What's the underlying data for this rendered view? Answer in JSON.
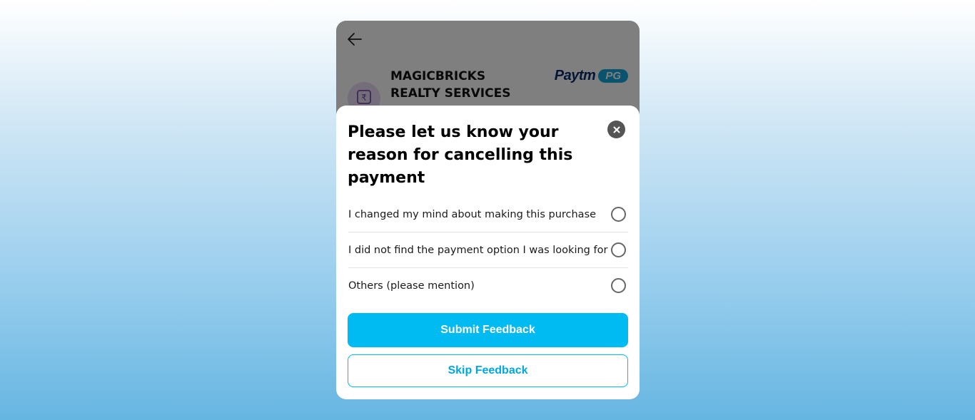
{
  "merchant": {
    "name": "MAGICBRICKS REALTY SERVICES",
    "logo_icon": "rupee-wallet-icon"
  },
  "brand": {
    "paytm_label": "Paytm",
    "pg_label": "PG",
    "paytm_color": "#0a2e6f",
    "pg_color": "#12a7de"
  },
  "header": {
    "back_icon": "back-arrow-icon"
  },
  "feedback_modal": {
    "title": "Please let us know your reason for cancelling this payment",
    "close_icon": "close-icon",
    "reasons": [
      {
        "label": "I changed my mind about making this purchase",
        "selected": false
      },
      {
        "label": "I did not find the payment option I was looking for",
        "selected": false
      },
      {
        "label": "Others (please mention)",
        "selected": false
      }
    ],
    "submit_label": "Submit Feedback",
    "skip_label": "Skip Feedback",
    "accent_color": "#00baf2"
  }
}
